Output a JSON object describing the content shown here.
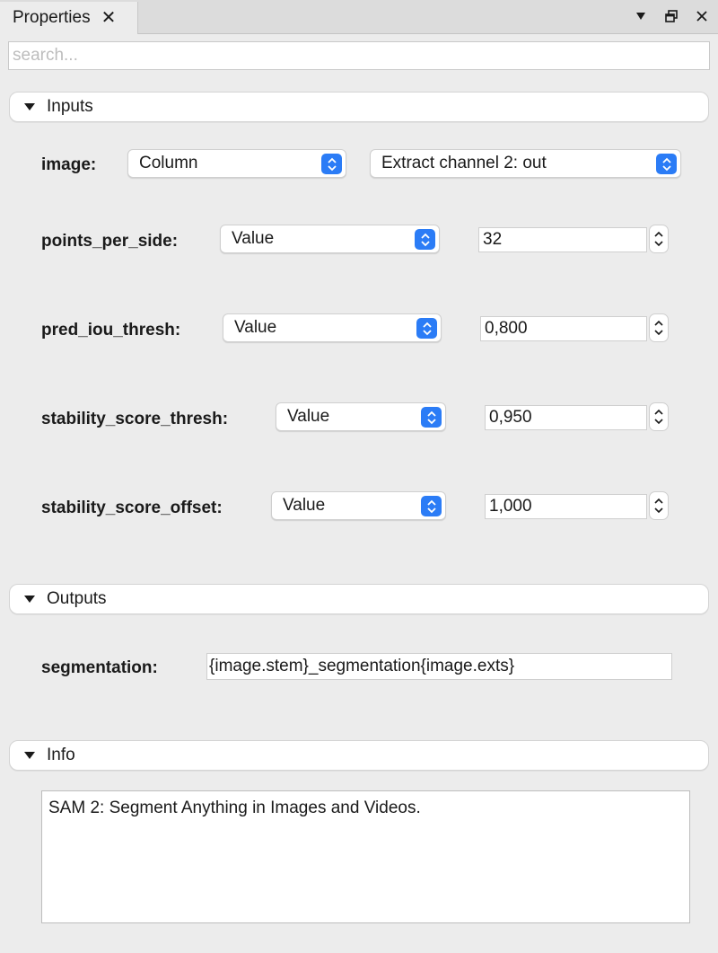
{
  "tab": {
    "label": "Properties"
  },
  "search": {
    "placeholder": "search..."
  },
  "sections": {
    "inputs": "Inputs",
    "outputs": "Outputs",
    "info": "Info"
  },
  "inputs": {
    "image": {
      "label": "image:",
      "source": "Column",
      "value": "Extract channel 2: out"
    },
    "points_per_side": {
      "label": "points_per_side:",
      "source": "Value",
      "value": "32"
    },
    "pred_iou_thresh": {
      "label": "pred_iou_thresh:",
      "source": "Value",
      "value": "0,800"
    },
    "stability_score_thresh": {
      "label": "stability_score_thresh:",
      "source": "Value",
      "value": "0,950"
    },
    "stability_score_offset": {
      "label": "stability_score_offset:",
      "source": "Value",
      "value": "1,000"
    }
  },
  "outputs": {
    "segmentation": {
      "label": "segmentation:",
      "value": "{image.stem}_segmentation{image.exts}"
    }
  },
  "info": {
    "text": "SAM 2: Segment Anything in Images and Videos."
  },
  "colors": {
    "accent": "#2b7cf6",
    "background": "#ececec"
  }
}
